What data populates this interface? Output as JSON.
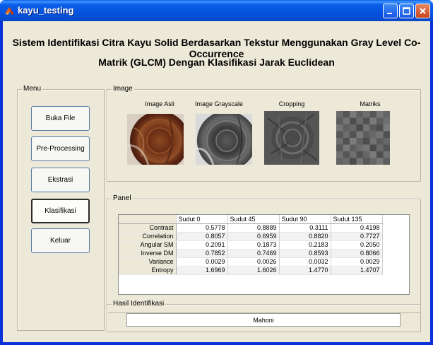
{
  "window": {
    "title": "kayu_testing",
    "title_bar_color": "#0a5ee8",
    "client_background": "#ece9d8"
  },
  "heading": {
    "line1": "Sistem Identifikasi Citra Kayu Solid Berdasarkan Tekstur Menggunakan Gray Level Co- Occurrence",
    "line2": "Matrik (GLCM) Dengan Klasifikasi Jarak Euclidean"
  },
  "menu": {
    "title": "Menu",
    "buttons": [
      "Buka File",
      "Pre-Processing",
      "Ekstrasi",
      "Klasifikasi",
      "Keluar"
    ],
    "active": "Klasifikasi"
  },
  "image_panel": {
    "title": "Image",
    "labels": [
      "Image Asli",
      "Image Grayscale",
      "Cropping",
      "Matriks"
    ]
  },
  "panel": {
    "title": "Panel",
    "columns": [
      "Sudut 0",
      "Sudut 45",
      "Sudut 90",
      "Sudut 135"
    ],
    "rows": [
      {
        "label": "Contrast",
        "values": [
          "0.5778",
          "0.8889",
          "0.3111",
          "0.4198"
        ]
      },
      {
        "label": "Correlation",
        "values": [
          "0.8057",
          "0.6959",
          "0.8820",
          "0.7727"
        ]
      },
      {
        "label": "Angular SM",
        "values": [
          "0.2091",
          "0.1873",
          "0.2183",
          "0.2050"
        ]
      },
      {
        "label": "Inverse DM",
        "values": [
          "0.7852",
          "0.7469",
          "0.8593",
          "0.8066"
        ]
      },
      {
        "label": "Variance",
        "values": [
          "0.0029",
          "0.0026",
          "0.0032",
          "0.0029"
        ]
      },
      {
        "label": "Entropy",
        "values": [
          "1.6969",
          "1.6026",
          "1.4770",
          "1.4707"
        ]
      }
    ]
  },
  "hasil": {
    "title": "Hasil Identifikasi",
    "result": "Mahoni"
  }
}
